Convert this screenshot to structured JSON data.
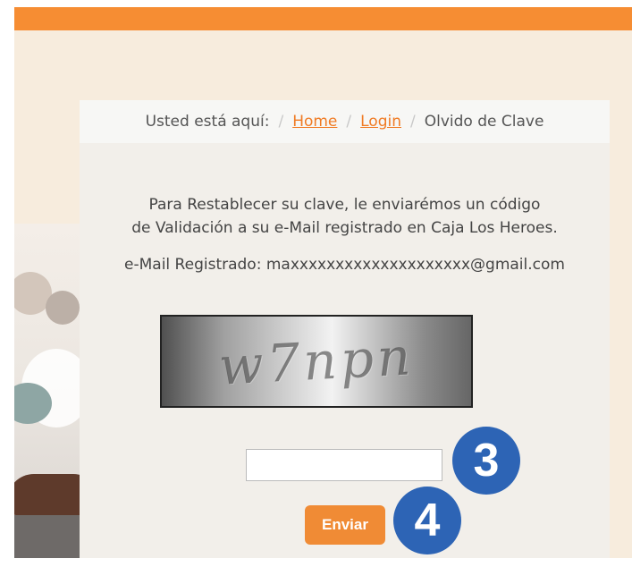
{
  "breadcrumb": {
    "prefix": "Usted está aquí:",
    "separator": "/",
    "home": "Home",
    "login": "Login",
    "current": "Olvido de Clave"
  },
  "message": {
    "line1": "Para Restablecer su clave, le enviarémos un código",
    "line2": "de Validación a su e-Mail registrado en Caja Los Heroes.",
    "email_label": "e-Mail Registrado:",
    "email_value": "maxxxxxxxxxxxxxxxxxxxx@gmail.com"
  },
  "captcha": {
    "text": "w7npn",
    "input_value": "",
    "input_placeholder": ""
  },
  "actions": {
    "submit_label": "Enviar"
  },
  "annotations": {
    "step_three": "3",
    "step_four": "4"
  },
  "colors": {
    "accent": "#f68d33",
    "link": "#f07b24",
    "badge": "#2d64b5",
    "background": "#f7ecdd",
    "panel": "#f2efea"
  }
}
